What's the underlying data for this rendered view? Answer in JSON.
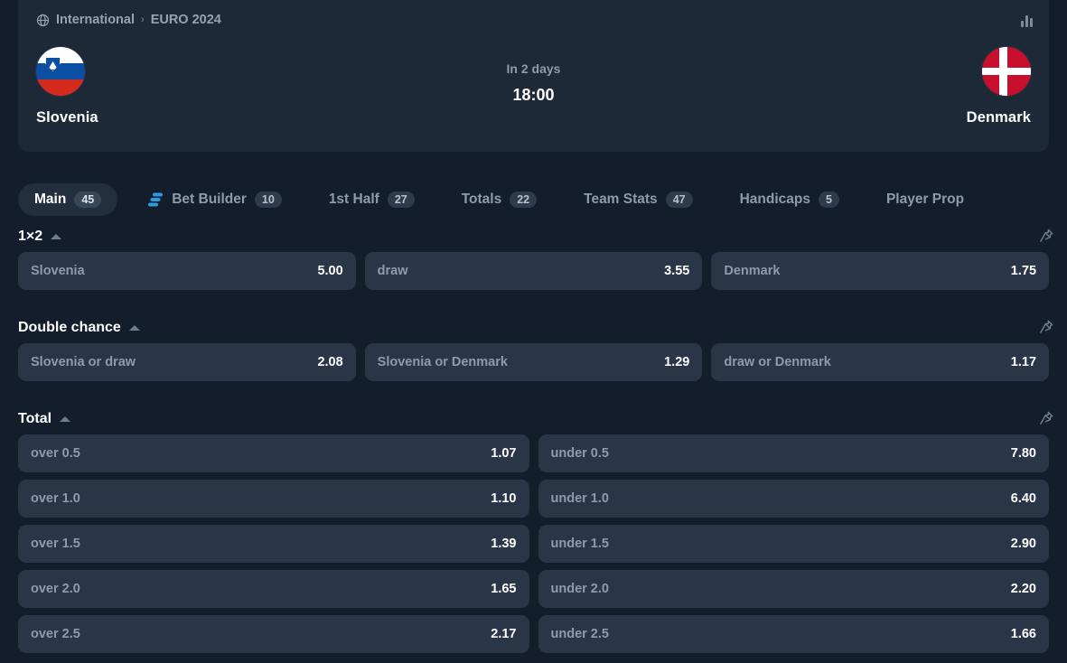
{
  "header": {
    "breadcrumb": {
      "category": "International",
      "separator": "›",
      "competition": "EURO 2024",
      "globe_icon": "globe-icon"
    },
    "stats_icon": "bar-chart-icon",
    "home_team": "Slovenia",
    "away_team": "Denmark",
    "when": "In 2 days",
    "time": "18:00"
  },
  "tabs": [
    {
      "label": "Main",
      "count": "45",
      "active": true,
      "icon": ""
    },
    {
      "label": "Bet Builder",
      "count": "10",
      "active": false,
      "icon": "bet-builder-icon"
    },
    {
      "label": "1st Half",
      "count": "27",
      "active": false,
      "icon": ""
    },
    {
      "label": "Totals",
      "count": "22",
      "active": false,
      "icon": ""
    },
    {
      "label": "Team Stats",
      "count": "47",
      "active": false,
      "icon": ""
    },
    {
      "label": "Handicaps",
      "count": "5",
      "active": false,
      "icon": ""
    },
    {
      "label": "Player Prop",
      "count": "",
      "active": false,
      "icon": ""
    }
  ],
  "markets": [
    {
      "title": "1×2",
      "pin_icon": "pin-icon",
      "collapse_icon": "caret-up-icon",
      "rows": [
        [
          {
            "label": "Slovenia",
            "odds": "5.00"
          },
          {
            "label": "draw",
            "odds": "3.55"
          },
          {
            "label": "Denmark",
            "odds": "1.75"
          }
        ]
      ]
    },
    {
      "title": "Double chance",
      "pin_icon": "pin-icon",
      "collapse_icon": "caret-up-icon",
      "rows": [
        [
          {
            "label": "Slovenia or draw",
            "odds": "2.08"
          },
          {
            "label": "Slovenia or Denmark",
            "odds": "1.29"
          },
          {
            "label": "draw or Denmark",
            "odds": "1.17"
          }
        ]
      ]
    },
    {
      "title": "Total",
      "pin_icon": "pin-icon",
      "collapse_icon": "caret-up-icon",
      "rows": [
        [
          {
            "label": "over 0.5",
            "odds": "1.07"
          },
          {
            "label": "under 0.5",
            "odds": "7.80"
          }
        ],
        [
          {
            "label": "over 1.0",
            "odds": "1.10"
          },
          {
            "label": "under 1.0",
            "odds": "6.40"
          }
        ],
        [
          {
            "label": "over 1.5",
            "odds": "1.39"
          },
          {
            "label": "under 1.5",
            "odds": "2.90"
          }
        ],
        [
          {
            "label": "over 2.0",
            "odds": "1.65"
          },
          {
            "label": "under 2.0",
            "odds": "2.20"
          }
        ],
        [
          {
            "label": "over 2.5",
            "odds": "2.17"
          },
          {
            "label": "under 2.5",
            "odds": "1.66"
          }
        ]
      ]
    }
  ],
  "colors": {
    "page_bg": "#141d2b",
    "card_bg": "#1e2937",
    "odd_bg": "#2a3647",
    "accent": "#2f9ae0",
    "muted_text": "#8d9bac",
    "white_text": "#ffffff"
  }
}
